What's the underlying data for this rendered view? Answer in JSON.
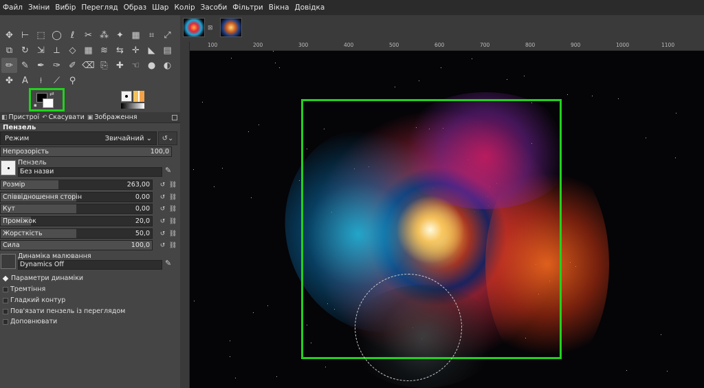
{
  "menubar": [
    "Файл",
    "Зміни",
    "Вибір",
    "Перегляд",
    "Образ",
    "Шар",
    "Колір",
    "Засоби",
    "Фільтри",
    "Вікна",
    "Довідка"
  ],
  "toolbox": {
    "rows": [
      [
        "move-tool-icon",
        "align-tool-icon",
        "rect-select-icon",
        "ellipse-select-icon",
        "free-select-icon",
        "scissors-select-icon",
        "fuzzy-select-icon",
        "magic-wand-icon",
        "color-select-icon",
        "crop-tool-icon",
        "transform-tool-icon"
      ],
      [
        "unified-transform-icon",
        "rotate-tool-icon",
        "scale-tool-icon",
        "shear-tool-icon",
        "perspective-tool-icon",
        "cage-tool-icon",
        "warp-tool-icon",
        "flip-tool-icon",
        "handle-transform-icon",
        "bucket-fill-icon",
        "gradient-tool-icon"
      ],
      [
        "paintbrush-icon",
        "pencil-icon",
        "airbrush-icon",
        "ink-icon",
        "mypaint-brush-icon",
        "eraser-icon",
        "clone-tool-icon",
        "heal-tool-icon",
        "smudge-tool-icon",
        "blur-tool-icon",
        "dodge-tool-icon"
      ],
      [
        "paths-tool-icon",
        "text-tool-icon",
        "color-picker-icon",
        "measure-tool-icon",
        "zoom-tool-icon"
      ]
    ],
    "glyphs": [
      [
        "✥",
        "⊢",
        "⬚",
        "◯",
        "ℓ",
        "✂",
        "⁂",
        "✦",
        "▦",
        "⌗",
        "⤢"
      ],
      [
        "⧉",
        "↻",
        "⇲",
        "⟂",
        "◇",
        "▦",
        "≋",
        "⇆",
        "✛",
        "◣",
        "▤"
      ],
      [
        "✏",
        "✎",
        "✒",
        "✑",
        "✐",
        "⌫",
        "⎘",
        "✚",
        "☜",
        "●",
        "◐"
      ],
      [
        "✤",
        "A",
        "⟊",
        "⟋",
        "⚲"
      ]
    ]
  },
  "tabs": [
    {
      "icon": "device-status-icon",
      "label": "Пристрої"
    },
    {
      "icon": "undo-history-icon",
      "label": "Скасувати"
    },
    {
      "icon": "images-icon",
      "label": "Зображення"
    }
  ],
  "tool_options": {
    "title": "Пензель",
    "mode_label": "Режим",
    "mode_value": "Звичайний",
    "opacity": {
      "label": "Непрозорість",
      "value": "100,0",
      "fraction": 1.0
    },
    "brush": {
      "label": "Пензель",
      "name": "Без назви"
    },
    "sliders": [
      {
        "label": "Розмір",
        "value": "263,00",
        "fraction": 0.38
      },
      {
        "label": "Співвідношення сторін",
        "value": "0,00",
        "fraction": 0.5
      },
      {
        "label": "Кут",
        "value": "0,00",
        "fraction": 0.5
      },
      {
        "label": "Проміжок",
        "value": "20,0",
        "fraction": 0.2
      },
      {
        "label": "Жорсткість",
        "value": "50,0",
        "fraction": 0.5
      }
    ],
    "force": {
      "label": "Сила",
      "value": "100,0",
      "fraction": 1.0
    },
    "dynamics": {
      "label": "Динаміка малювання",
      "name": "Dynamics Off"
    },
    "options": [
      {
        "label": "Параметри динаміки",
        "type": "expander"
      },
      {
        "label": "Тремтіння",
        "type": "checkbox"
      },
      {
        "label": "Гладкий контур",
        "type": "checkbox"
      },
      {
        "label": "Пов'язати пензель із переглядом",
        "type": "checkbox"
      },
      {
        "label": "Доповнювати",
        "type": "checkbox"
      }
    ]
  },
  "ruler": [
    "100",
    "200",
    "300",
    "400",
    "500",
    "600",
    "700",
    "800",
    "900",
    "1000",
    "1100"
  ],
  "colors": {
    "accent": "#22d11e",
    "fg": "#000000",
    "bg": "#ffffff"
  }
}
